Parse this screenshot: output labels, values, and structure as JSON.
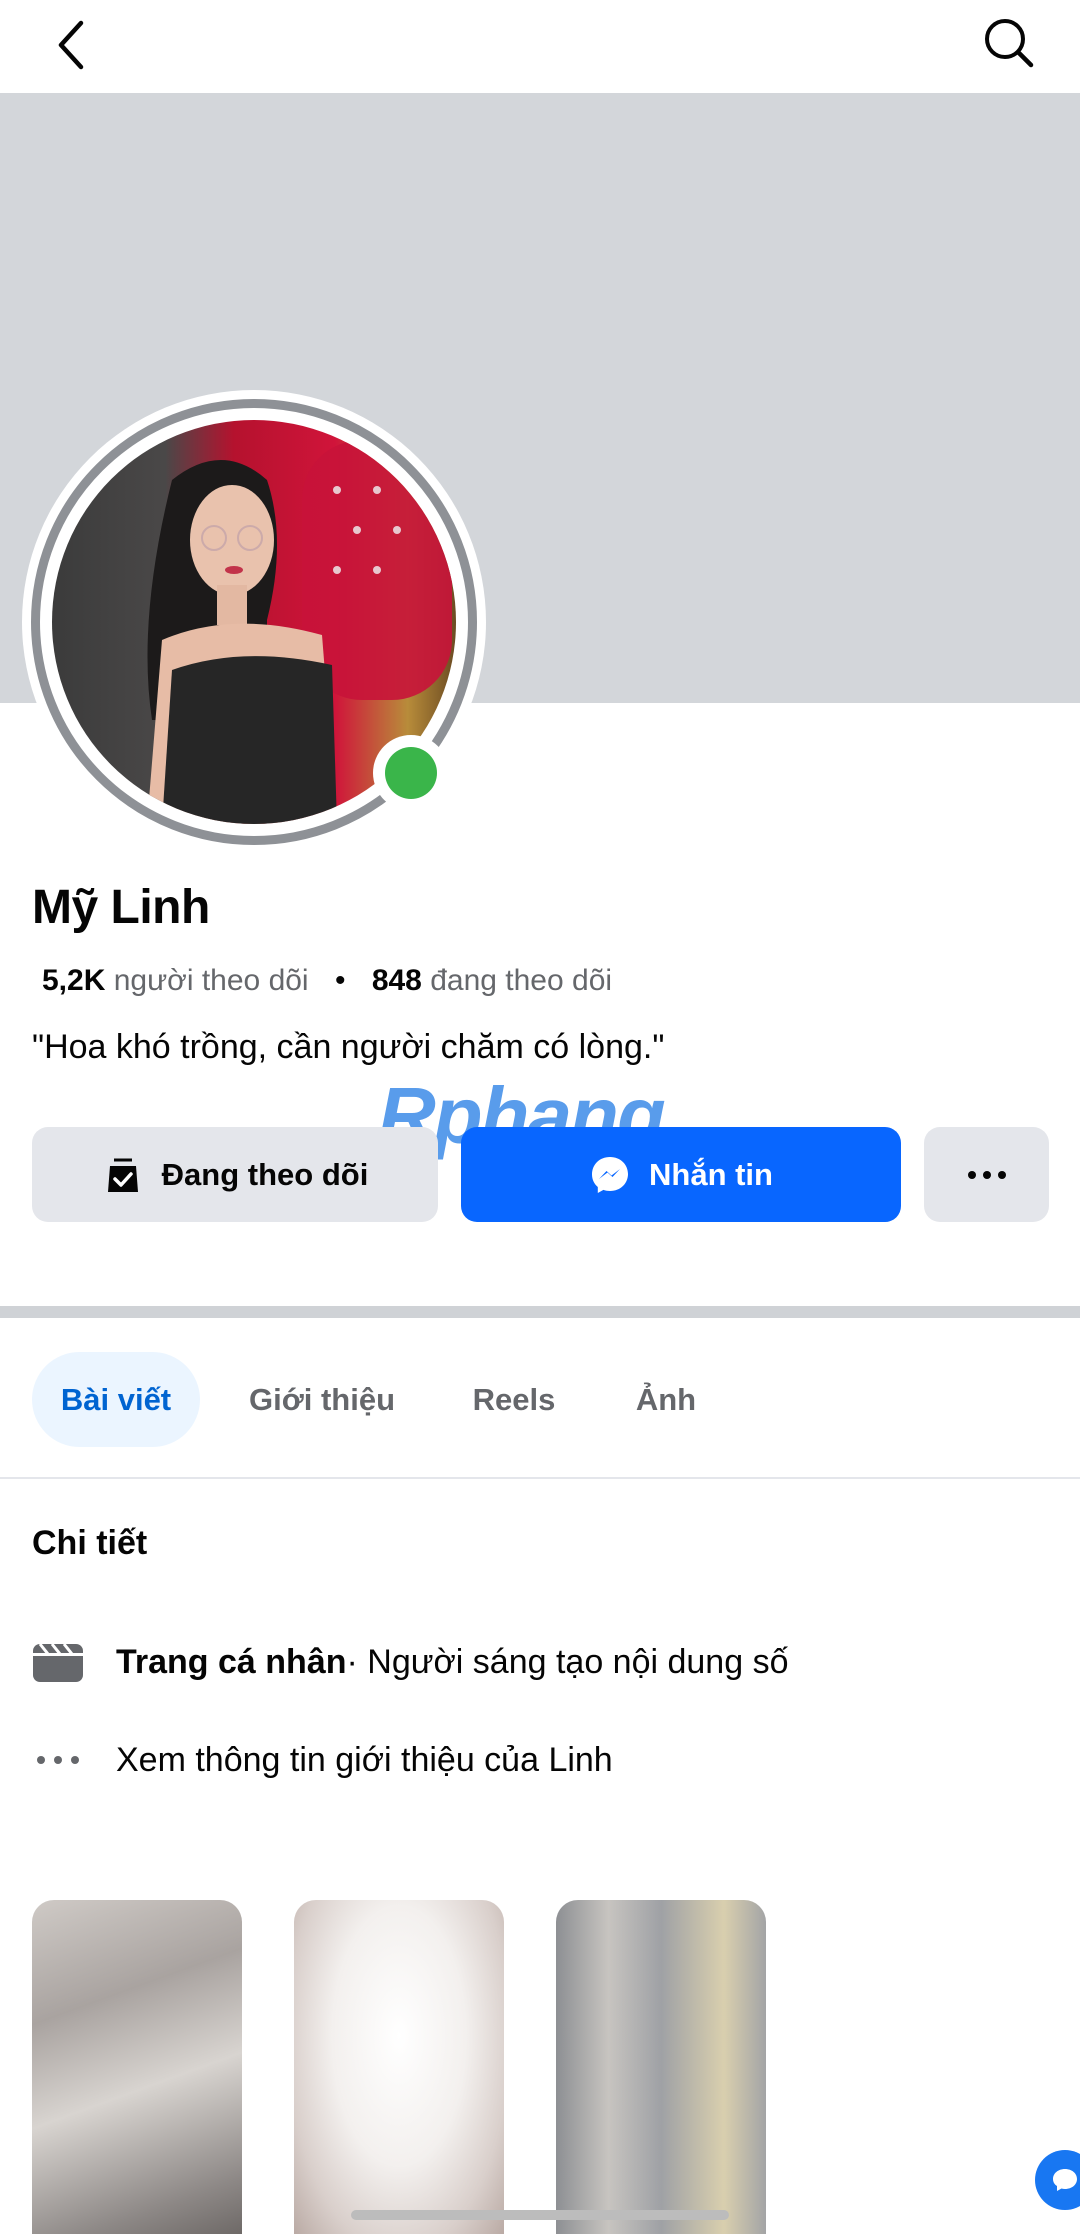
{
  "topbar": {
    "back_icon": "chevron-left-icon",
    "search_icon": "search-icon"
  },
  "profile": {
    "name": "Mỹ Linh",
    "online": true,
    "followers_count": "5,2K",
    "followers_label": "người theo dõi",
    "separator": "•",
    "following_count": "848",
    "following_label": "đang theo dõi",
    "bio": "\"Hoa khó trồng, cần người chăm có lòng.\""
  },
  "watermark": {
    "text": "Rphang"
  },
  "actions": {
    "follow_label": "Đang theo dõi",
    "follow_icon": "following-check-icon",
    "message_label": "Nhắn tin",
    "message_icon": "messenger-icon",
    "more_label": "···",
    "colors": {
      "primary": "#0866ff",
      "secondary": "#e4e6eb"
    }
  },
  "tabs": [
    {
      "label": "Bài viết",
      "active": true
    },
    {
      "label": "Giới thiệu",
      "active": false
    },
    {
      "label": "Reels",
      "active": false
    },
    {
      "label": "Ảnh",
      "active": false
    }
  ],
  "details": {
    "title": "Chi tiết",
    "row1_bold": "Trang cá nhân",
    "row1_rest": " · Người sáng tạo nội dung số",
    "row1_icon": "clapperboard-icon",
    "row2_text": "Xem thông tin giới thiệu của Linh",
    "row2_icon": "more-dots-icon"
  },
  "thumbnails": [
    {
      "name": "reel-thumbnail-1"
    },
    {
      "name": "reel-thumbnail-2"
    },
    {
      "name": "reel-thumbnail-3"
    }
  ]
}
